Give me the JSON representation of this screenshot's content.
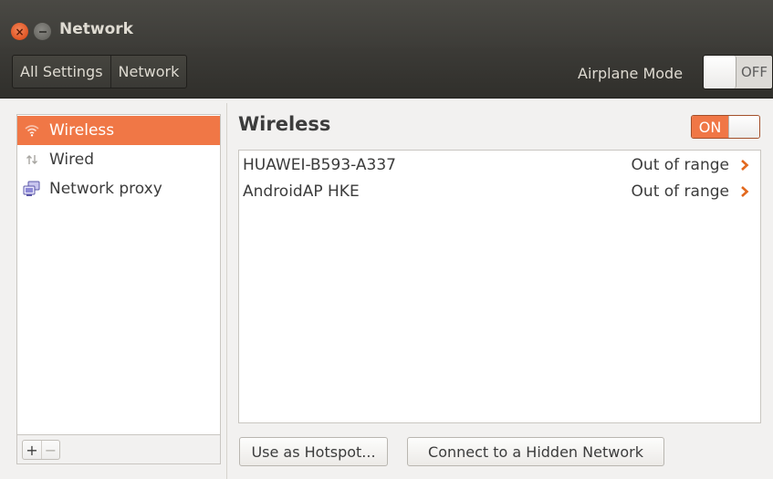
{
  "window": {
    "title": "Network",
    "close_glyph": "×",
    "icons": {
      "close": "close-icon",
      "minimize": "minimize-icon"
    }
  },
  "toolbar": {
    "breadcrumbs": [
      "All Settings",
      "Network"
    ],
    "airplane_mode_label": "Airplane Mode",
    "airplane_mode_state": "OFF"
  },
  "sidebar": {
    "items": [
      {
        "label": "Wireless",
        "icon": "wifi-icon",
        "selected": true
      },
      {
        "label": "Wired",
        "icon": "wired-icon",
        "selected": false
      },
      {
        "label": "Network proxy",
        "icon": "network-proxy-icon",
        "selected": false
      }
    ],
    "add_label": "+",
    "remove_label": "−"
  },
  "panel": {
    "title": "Wireless",
    "wifi_state": "ON",
    "networks": [
      {
        "name": "HUAWEI-B593-A337",
        "status": "Out of range",
        "icon": "chevron-right-icon"
      },
      {
        "name": "AndroidAP HKE",
        "status": "Out of range",
        "icon": "chevron-right-icon"
      }
    ],
    "hotspot_button": "Use as Hotspot...",
    "hidden_network_button": "Connect to a Hidden Network"
  },
  "colors": {
    "accent": "#f07746",
    "titlebar": "#3d3c38",
    "background": "#f2f1f0"
  }
}
